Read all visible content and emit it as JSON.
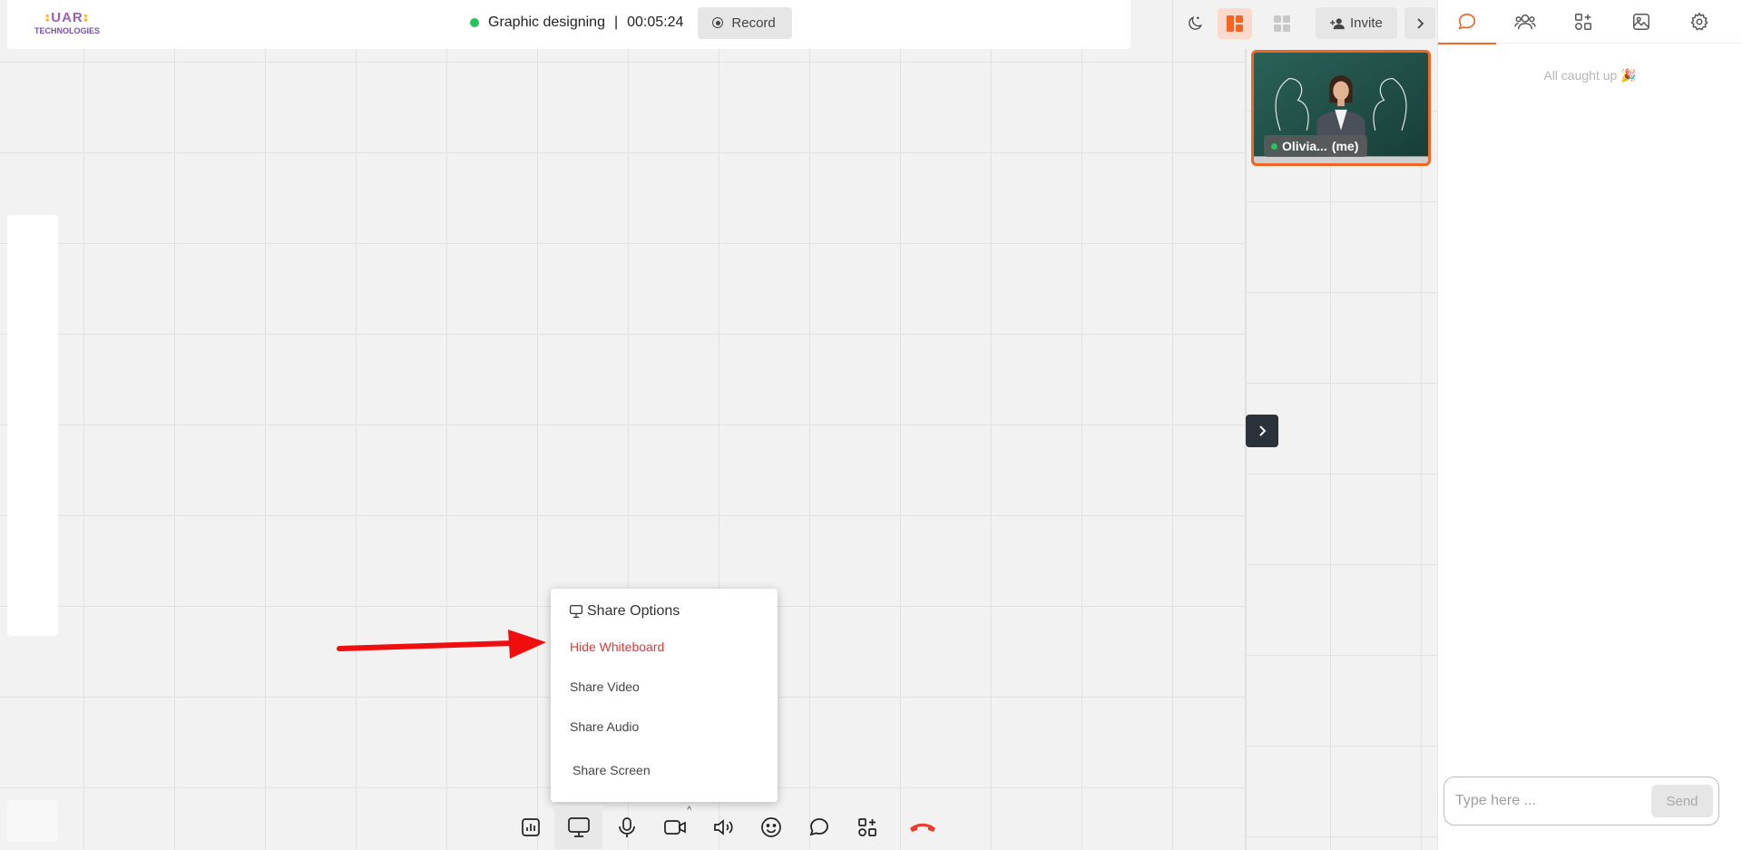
{
  "logo": {
    "line1": "UAR",
    "line2": "TECHNOLOGIES"
  },
  "meeting": {
    "title": "Graphic designing",
    "separator": "|",
    "timer": "00:05:24",
    "record_label": "Record"
  },
  "header": {
    "invite_label": "Invite"
  },
  "participant": {
    "name": "Olivia...",
    "suffix": "(me)"
  },
  "chat": {
    "empty_state": "All caught up 🎉",
    "input_placeholder": "Type here ...",
    "send_label": "Send"
  },
  "share_menu": {
    "title": "Share Options",
    "items": [
      {
        "label": "Hide Whiteboard"
      },
      {
        "label": "Share Video"
      },
      {
        "label": "Share Audio"
      },
      {
        "label": "Share Screen"
      }
    ]
  },
  "colors": {
    "accent": "#f26522",
    "danger": "#e53935",
    "live": "#22c55e"
  },
  "icons": {
    "toolbar": [
      "poll-icon",
      "whiteboard-icon",
      "microphone-icon",
      "camera-icon",
      "speaker-icon",
      "emoji-icon",
      "chat-icon",
      "apps-icon",
      "end-call-icon"
    ],
    "chat_tabs": [
      "chat-icon",
      "participants-icon",
      "apps-icon",
      "gallery-icon",
      "settings-icon"
    ]
  }
}
